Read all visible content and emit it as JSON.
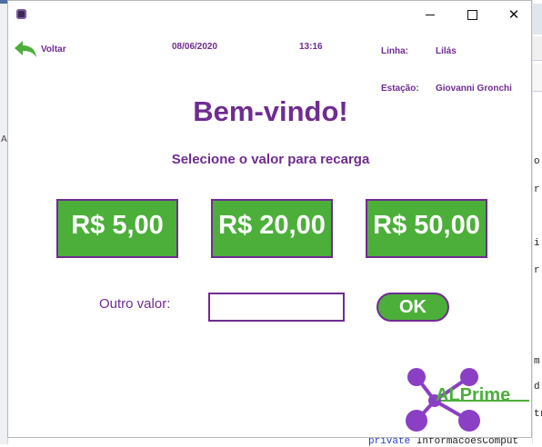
{
  "window": {
    "minimize_glyph": "",
    "close_glyph": "✕"
  },
  "header": {
    "back_label": "Voltar",
    "date": "08/06/2020",
    "time": "13:16",
    "linha_label": "Linha:",
    "linha_value": "Lilás",
    "estacao_label": "Estação:",
    "estacao_value": "Giovanni Gronchi"
  },
  "main": {
    "welcome": "Bem-vindo!",
    "subtitle": "Selecione o valor para recarga",
    "amounts": [
      "R$ 5,00",
      "R$ 20,00",
      "R$ 50,00"
    ],
    "other_label": "Outro valor:",
    "other_value": "",
    "ok_label": "OK"
  },
  "logo": {
    "text": "ALPrime",
    "icon": "molecule-logo-icon"
  },
  "background": {
    "left_char": "A",
    "right_chunks": [
      "o",
      "r",
      "i",
      "r",
      "tr",
      "m",
      "d",
      "tr"
    ],
    "bottom_code_kw": "private",
    "bottom_code_rest": " InformacoesComput"
  },
  "colors": {
    "brand_purple": "#6f2c91",
    "brand_green": "#4caf3a"
  }
}
